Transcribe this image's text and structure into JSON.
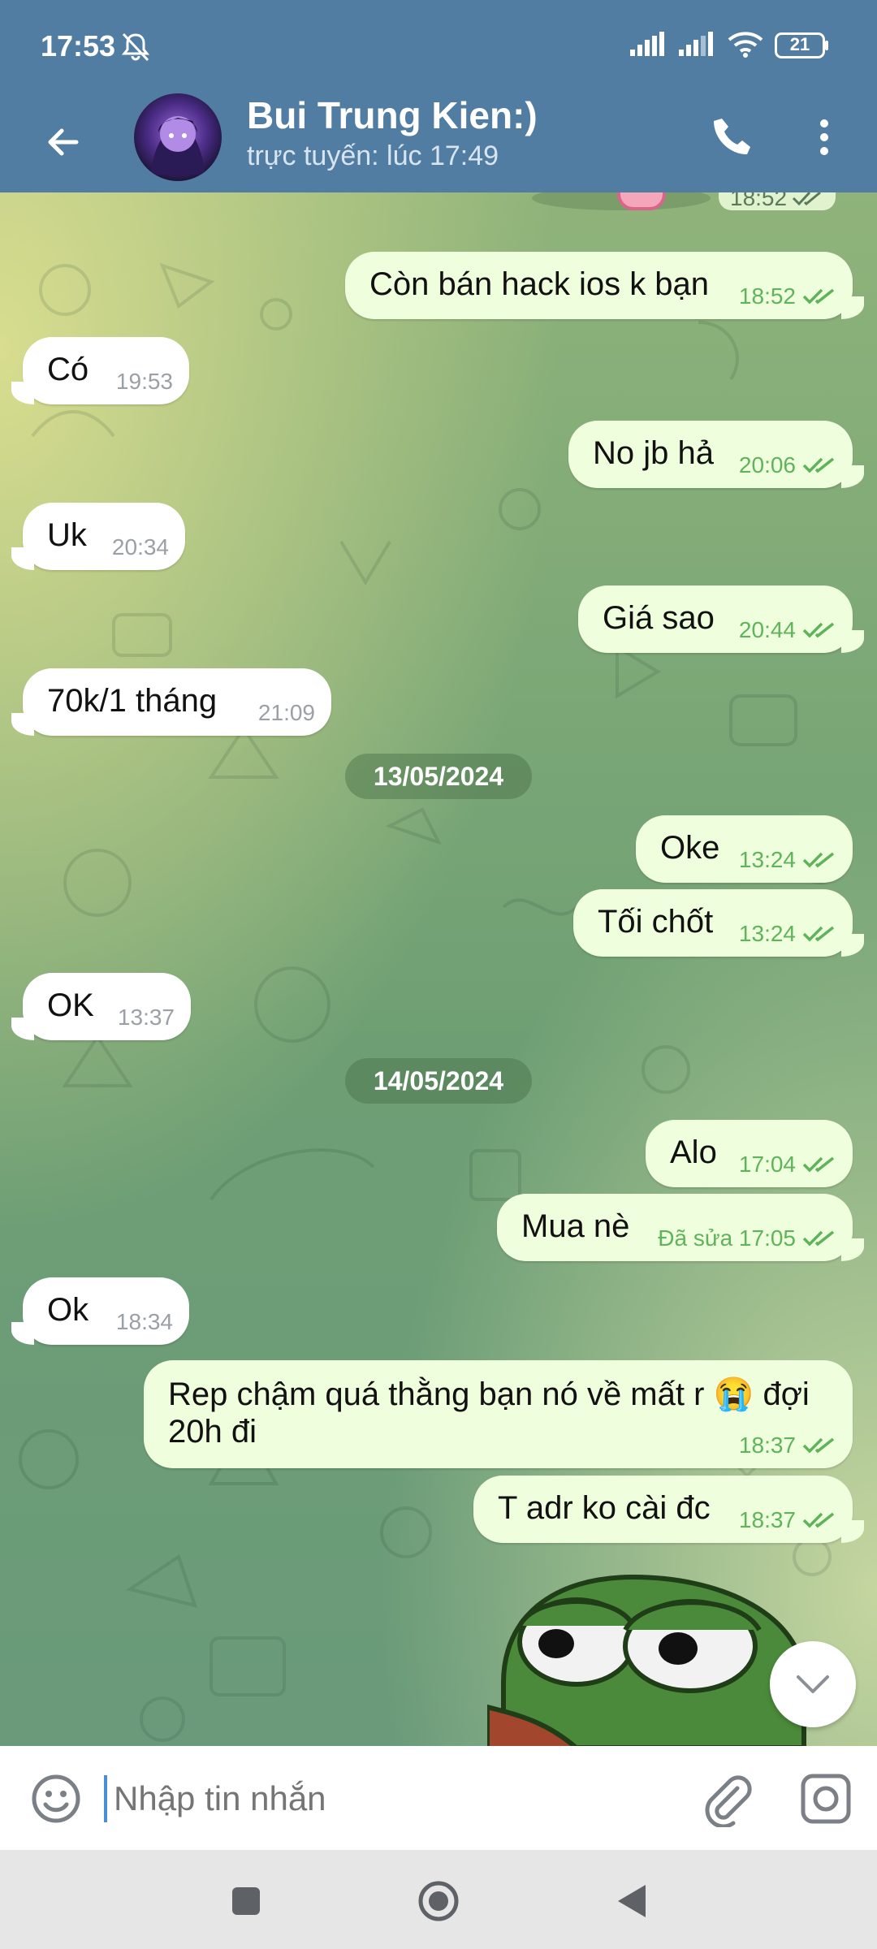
{
  "status_bar": {
    "time": "17:53",
    "battery": "21"
  },
  "header": {
    "title": "Bui Trung Kien:)",
    "subtitle": "trực tuyến: lúc 17:49"
  },
  "partial_top_time": "18:52",
  "messages": [
    {
      "dir": "out",
      "text": "Còn bán hack ios k bạn",
      "time": "18:52",
      "read": true
    },
    {
      "dir": "in",
      "text": "Có",
      "time": "19:53"
    },
    {
      "dir": "out",
      "text": "No jb hả",
      "time": "20:06",
      "read": true
    },
    {
      "dir": "in",
      "text": "Uk",
      "time": "20:34"
    },
    {
      "dir": "out",
      "text": "Giá sao",
      "time": "20:44",
      "read": true
    },
    {
      "dir": "in",
      "text": "70k/1 tháng",
      "time": "21:09"
    },
    {
      "dir": "out",
      "text": "Oke",
      "time": "13:24",
      "read": true
    },
    {
      "dir": "out",
      "text": "Tối chốt",
      "time": "13:24",
      "read": true
    },
    {
      "dir": "in",
      "text": "OK",
      "time": "13:37"
    },
    {
      "dir": "out",
      "text": "Alo",
      "time": "17:04",
      "read": true
    },
    {
      "dir": "out",
      "text": "Mua nè",
      "time": "Đã sửa 17:05",
      "read": true
    },
    {
      "dir": "in",
      "text": "Ok",
      "time": "18:34"
    },
    {
      "dir": "out",
      "text_line1": "Rep chậm quá thằng bạn nó về mất r 😭 đợi",
      "text_line2": "20h đi",
      "time": "18:37",
      "read": true
    },
    {
      "dir": "out",
      "text": "T adr ko cài đc",
      "time": "18:37",
      "read": true
    }
  ],
  "date_separators": [
    "13/05/2024",
    "14/05/2024"
  ],
  "input": {
    "placeholder": "Nhập tin nhắn"
  },
  "colors": {
    "header": "#527da3",
    "out_bubble": "#effedd",
    "in_bubble": "#ffffff",
    "read_check": "#5fb35a"
  }
}
